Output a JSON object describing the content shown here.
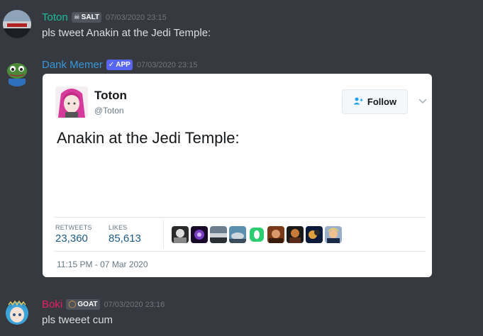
{
  "messages": [
    {
      "username": "Toton",
      "username_color": "#1abc9c",
      "badge_icon": "skull-icon",
      "badge_glyph": "☠",
      "badge_text": "SALT",
      "timestamp": "07/03/2020 23:15",
      "content": "pls tweet Anakin at the Jedi Temple:"
    },
    {
      "username": "Dank Memer",
      "username_color": "#3498db",
      "badge_glyph": "✓",
      "badge_text": "APP",
      "timestamp": "07/03/2020 23:15"
    },
    {
      "username": "Boki",
      "username_color": "#e91e63",
      "badge_glyph": "◯",
      "badge_text": "GOAT",
      "timestamp": "07/03/2020 23:16",
      "content": "pls tweeet cum"
    }
  ],
  "tweet": {
    "name": "Toton",
    "handle": "@Toton",
    "follow_label": "Follow",
    "text": "Anakin at the Jedi Temple:",
    "retweets_label": "RETWEETS",
    "retweets": "23,360",
    "likes_label": "LIKES",
    "likes": "85,613",
    "date": "11:15 PM - 07 Mar 2020"
  },
  "colors": {
    "background": "#36393f",
    "timestamp": "#72767d",
    "twitter_blue": "#1da1f2"
  }
}
